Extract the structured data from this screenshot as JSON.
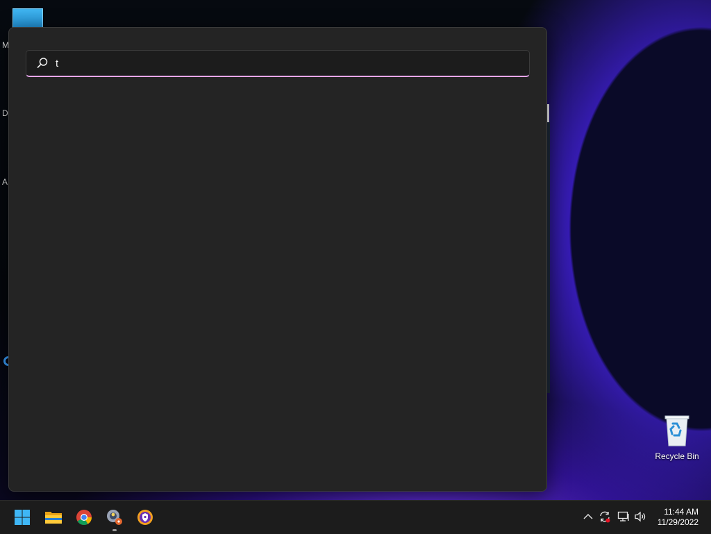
{
  "desktop": {
    "side_letters": [
      "M",
      "D",
      "A"
    ],
    "recycle_bin_label": "Recycle Bin"
  },
  "search": {
    "query": "t",
    "accent_color": "#e9a6ef"
  },
  "taskbar": {
    "apps": [
      {
        "name": "start-button",
        "icon": "windows-logo-icon"
      },
      {
        "name": "file-explorer",
        "icon": "folder-icon"
      },
      {
        "name": "chrome",
        "icon": "chrome-icon"
      },
      {
        "name": "pinned-app",
        "icon": "app-icon"
      },
      {
        "name": "browser-app",
        "icon": "shield-browser-icon"
      }
    ],
    "tray": [
      "chevron-up-icon",
      "sync-icon",
      "network-icon",
      "volume-icon"
    ],
    "clock": {
      "time": "11:44 AM",
      "date": "11/29/2022"
    }
  }
}
